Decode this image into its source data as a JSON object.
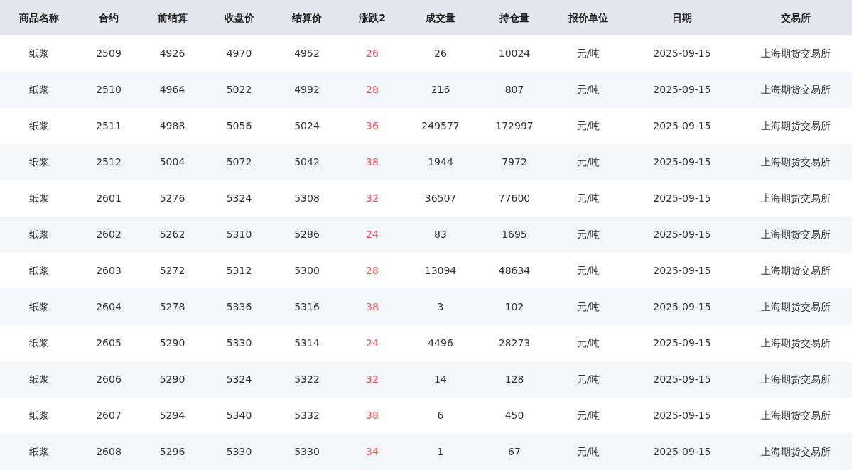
{
  "table": {
    "columns": [
      "商品名称",
      "合约",
      "前结算",
      "收盘价",
      "结算价",
      "涨跌2",
      "成交量",
      "持仓量",
      "报价单位",
      "日期",
      "交易所"
    ],
    "rows": [
      [
        "纸浆",
        "2509",
        "4926",
        "4970",
        "4952",
        "26",
        "26",
        "10024",
        "元/吨",
        "2025-09-15",
        "上海期货交易所"
      ],
      [
        "纸浆",
        "2510",
        "4964",
        "5022",
        "4992",
        "28",
        "216",
        "807",
        "元/吨",
        "2025-09-15",
        "上海期货交易所"
      ],
      [
        "纸浆",
        "2511",
        "4988",
        "5056",
        "5024",
        "36",
        "249577",
        "172997",
        "元/吨",
        "2025-09-15",
        "上海期货交易所"
      ],
      [
        "纸浆",
        "2512",
        "5004",
        "5072",
        "5042",
        "38",
        "1944",
        "7972",
        "元/吨",
        "2025-09-15",
        "上海期货交易所"
      ],
      [
        "纸浆",
        "2601",
        "5276",
        "5324",
        "5308",
        "32",
        "36507",
        "77600",
        "元/吨",
        "2025-09-15",
        "上海期货交易所"
      ],
      [
        "纸浆",
        "2602",
        "5262",
        "5310",
        "5286",
        "24",
        "83",
        "1695",
        "元/吨",
        "2025-09-15",
        "上海期货交易所"
      ],
      [
        "纸浆",
        "2603",
        "5272",
        "5312",
        "5300",
        "28",
        "13094",
        "48634",
        "元/吨",
        "2025-09-15",
        "上海期货交易所"
      ],
      [
        "纸浆",
        "2604",
        "5278",
        "5336",
        "5316",
        "38",
        "3",
        "102",
        "元/吨",
        "2025-09-15",
        "上海期货交易所"
      ],
      [
        "纸浆",
        "2605",
        "5290",
        "5330",
        "5314",
        "24",
        "4496",
        "28273",
        "元/吨",
        "2025-09-15",
        "上海期货交易所"
      ],
      [
        "纸浆",
        "2606",
        "5290",
        "5324",
        "5322",
        "32",
        "14",
        "128",
        "元/吨",
        "2025-09-15",
        "上海期货交易所"
      ],
      [
        "纸浆",
        "2607",
        "5294",
        "5340",
        "5332",
        "38",
        "6",
        "450",
        "元/吨",
        "2025-09-15",
        "上海期货交易所"
      ],
      [
        "纸浆",
        "2608",
        "5296",
        "5330",
        "5330",
        "34",
        "1",
        "67",
        "元/吨",
        "2025-09-15",
        "上海期货交易所"
      ]
    ]
  }
}
